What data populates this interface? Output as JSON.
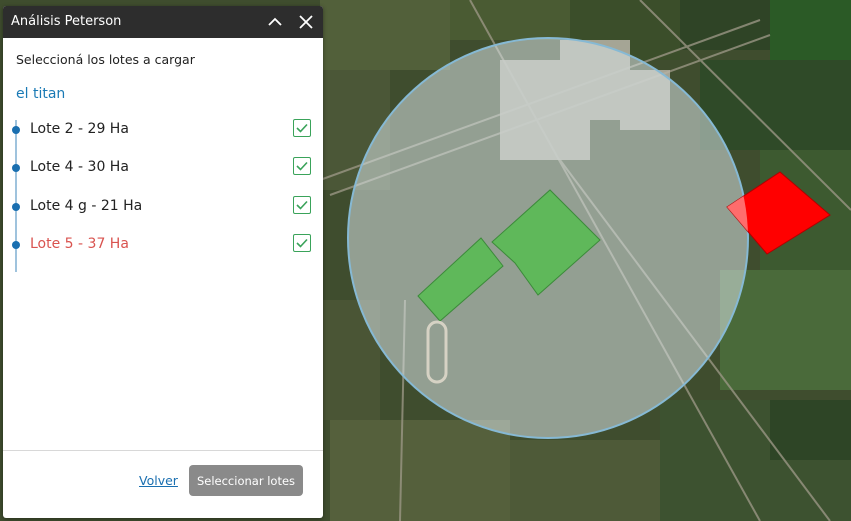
{
  "panel": {
    "title": "Análisis Peterson",
    "prompt": "Seleccioná los lotes a cargar",
    "group_name": "el titan",
    "lots": [
      {
        "label": "Lote 2 - 29 Ha",
        "checked": true,
        "status": "normal"
      },
      {
        "label": "Lote 4 - 30 Ha",
        "checked": true,
        "status": "normal"
      },
      {
        "label": "Lote 4 g - 21 Ha",
        "checked": true,
        "status": "normal"
      },
      {
        "label": "Lote 5 - 37 Ha",
        "checked": true,
        "status": "warning"
      }
    ],
    "back_label": "Volver",
    "select_label": "Seleccionar lotes"
  },
  "colors": {
    "header_bg": "#2d2d2d",
    "accent_blue": "#1a7ab5",
    "warning_red": "#d9534f",
    "check_green": "#3aa35a",
    "lot_green": "#5fb85a",
    "lot_red": "#ff0000",
    "radius_fill": "#d8e4e6"
  },
  "icons": {
    "collapse": "chevron-up-icon",
    "close": "close-icon",
    "check": "checkmark-icon"
  }
}
